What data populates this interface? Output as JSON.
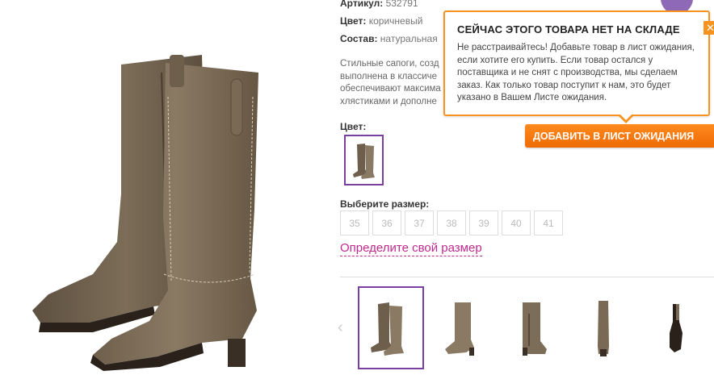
{
  "product": {
    "article_label": "Артикул:",
    "article_value": "532791",
    "color_label": "Цвет:",
    "color_value": "коричневый",
    "composition_label": "Состав:",
    "composition_value": "натуральная",
    "description_lines": [
      "Стильные сапоги, созд",
      "выполнена в классиче",
      "обеспечивают максима",
      "хлястиками и дополне"
    ]
  },
  "color_section": {
    "label": "Цвет:"
  },
  "size_section": {
    "label": "Выберите размер:",
    "sizes": [
      "35",
      "36",
      "37",
      "38",
      "39",
      "40",
      "41"
    ],
    "guide_link": "Определите свой размер"
  },
  "popup": {
    "title": "СЕЙЧАС ЭТОГО ТОВАРА НЕТ НА СКЛАДЕ",
    "text": "Не расстраивайтесь! Добавьте товар в лист ожидания, если хотите его купить. Если товар остался у поставщика и не снят с производства, мы сделаем заказ. Как только товар поступит к нам, это будет указано в Вашем Листе ожидания.",
    "close_icon": "✕"
  },
  "waitlist_button": "ДОБАВИТЬ В ЛИСТ ОЖИДАНИЯ",
  "thumbnails": {
    "prev_icon": "‹",
    "items": [
      "pair-angle",
      "side",
      "inner-side",
      "back",
      "sole"
    ]
  },
  "colors": {
    "accent_purple": "#7b3fa0",
    "link_pink": "#c0298e",
    "orange": "#f7931e",
    "boot_brown": "#7a6a55"
  }
}
